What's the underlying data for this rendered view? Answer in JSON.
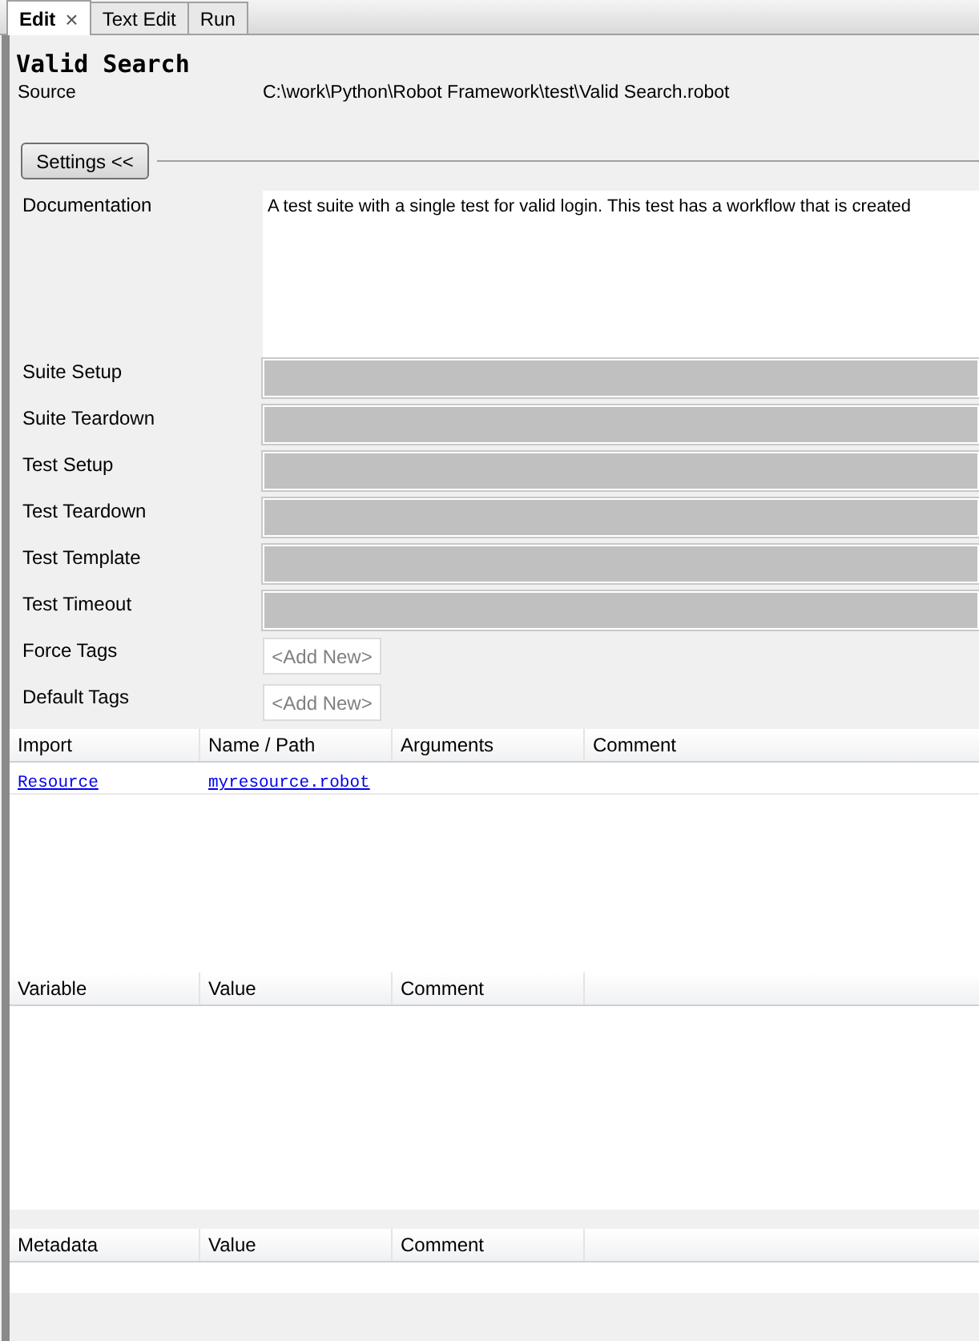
{
  "tabs": [
    {
      "label": "Edit",
      "selected": true,
      "close": "×"
    },
    {
      "label": "Text Edit",
      "selected": false
    },
    {
      "label": "Run",
      "selected": false
    }
  ],
  "suite": {
    "title": "Valid Search",
    "source_label": "Source",
    "source": "C:\\work\\Python\\Robot Framework\\test\\Valid Search.robot"
  },
  "settings_button": "Settings <<",
  "settings": [
    {
      "kind": "text",
      "label": "Documentation",
      "value": "A test suite with a single test for valid login. This test has a workflow that is created"
    },
    {
      "kind": "disabled",
      "label": "Suite Setup"
    },
    {
      "kind": "disabled",
      "label": "Suite Teardown"
    },
    {
      "kind": "disabled",
      "label": "Test Setup"
    },
    {
      "kind": "disabled",
      "label": "Test Teardown"
    },
    {
      "kind": "disabled",
      "label": "Test Template"
    },
    {
      "kind": "disabled",
      "label": "Test Timeout"
    },
    {
      "kind": "tags",
      "label": "Force Tags",
      "placeholder": "<Add New>"
    },
    {
      "kind": "tags",
      "label": "Default Tags",
      "placeholder": "<Add New>"
    }
  ],
  "imports": {
    "columns": [
      "Import",
      "Name / Path",
      "Arguments",
      "Comment"
    ],
    "rows": [
      [
        "Resource",
        "myresource.robot"
      ]
    ]
  },
  "variables": {
    "columns": [
      "Variable",
      "Value",
      "Comment"
    ]
  },
  "metadata": {
    "columns": [
      "Metadata",
      "Value",
      "Comment"
    ]
  }
}
